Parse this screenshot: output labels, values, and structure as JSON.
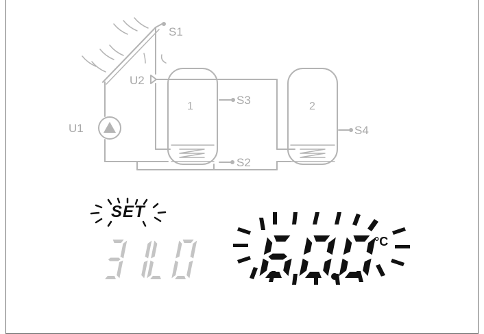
{
  "diagram": {
    "sensors": {
      "s1": "S1",
      "s2": "S2",
      "s3": "S3",
      "s4": "S4"
    },
    "valves": {
      "u1": "U1",
      "u2": "U2"
    },
    "tanks": {
      "tank1": "1",
      "tank2": "2"
    },
    "colors": {
      "diagram_line": "#b4b4b4",
      "active": "#111111",
      "inactive_segment": "#cfcfcf"
    }
  },
  "display": {
    "set_indicator": "SET",
    "parameter_code": "31L0",
    "value": "60.0",
    "unit": "°C"
  }
}
